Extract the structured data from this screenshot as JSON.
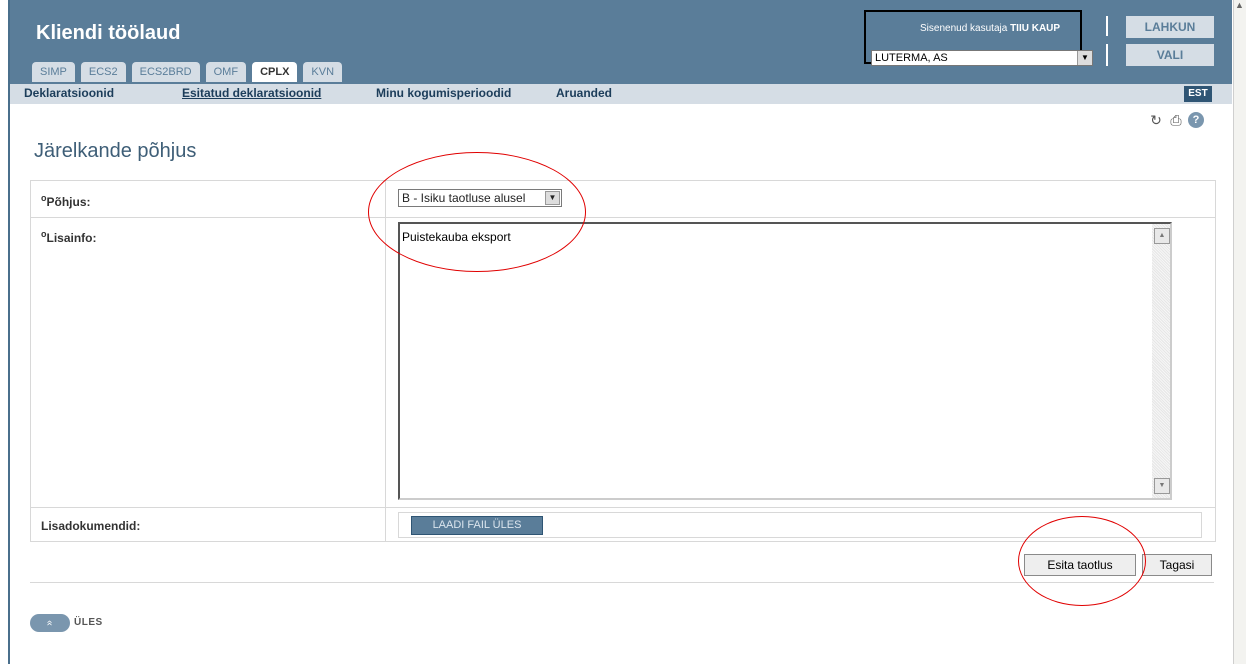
{
  "app": {
    "title": "Kliendi töölaud"
  },
  "tabs": [
    {
      "label": "SIMP",
      "active": false
    },
    {
      "label": "ECS2",
      "active": false
    },
    {
      "label": "ECS2BRD",
      "active": false
    },
    {
      "label": "OMF",
      "active": false
    },
    {
      "label": "CPLX",
      "active": true
    },
    {
      "label": "KVN",
      "active": false
    }
  ],
  "user": {
    "prefix": "Sisenenud kasutaja",
    "name": "TIIU KAUP",
    "company": "LUTERMA, AS"
  },
  "header_buttons": {
    "logout": "LAHKUN",
    "choose": "VALI"
  },
  "nav": {
    "items": [
      {
        "label": "Deklaratsioonid"
      },
      {
        "label": "Esitatud deklaratsioonid"
      },
      {
        "label": "Minu kogumisperioodid"
      },
      {
        "label": "Aruanded"
      }
    ],
    "language": "EST"
  },
  "tools": {
    "refresh": "refresh-icon",
    "print": "print-icon",
    "help": "?"
  },
  "page": {
    "title": "Järelkande põhjus"
  },
  "form": {
    "reason": {
      "label": "Põhjus:",
      "required_mark": "o",
      "value": "B - Isiku taotluse alusel"
    },
    "info": {
      "label": "Lisainfo:",
      "required_mark": "o",
      "value": "Puistekauba eksport"
    },
    "attachments": {
      "label": "Lisadokumendid:",
      "upload_label": "LAADI FAIL ÜLES"
    }
  },
  "actions": {
    "submit": "Esita taotlus",
    "back": "Tagasi"
  },
  "footer": {
    "up_label": "ÜLES",
    "up_icon": "»"
  },
  "colors": {
    "header": "#5a7d99",
    "nav": "#d5dde5",
    "annotation": "#e00000"
  }
}
